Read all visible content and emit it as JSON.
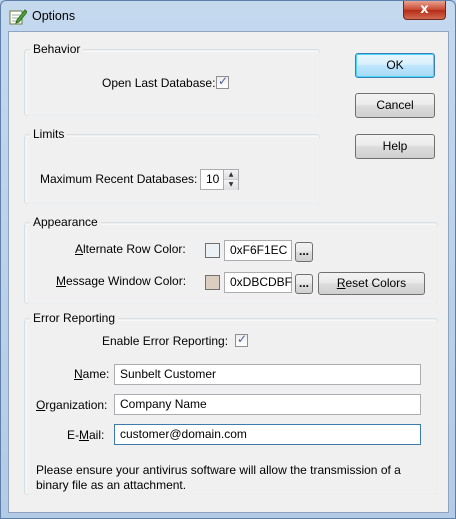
{
  "window": {
    "title": "Options",
    "close_glyph": "x",
    "icon": "notepad-pencil-icon"
  },
  "behavior": {
    "group_label": "Behavior",
    "open_last_db_label": "Open Last Database:",
    "open_last_db_checked": true
  },
  "limits": {
    "group_label": "Limits",
    "max_recent_label": "Maximum Recent Databases:",
    "max_recent_value": "10"
  },
  "appearance": {
    "group_label": "Appearance",
    "alt_row_label": "Alternate Row Color:",
    "alt_row_value": "0xF6F1EC",
    "alt_row_swatch": "#ECF1F6",
    "msg_window_label": "Message Window Color:",
    "msg_window_value": "0xDBCDBF",
    "msg_window_swatch": "#DBCDBF",
    "browse_label": "...",
    "reset_label": "Reset Colors"
  },
  "error_reporting": {
    "group_label": "Error Reporting",
    "enable_label": "Enable Error Reporting:",
    "enable_checked": true,
    "name_label": "Name:",
    "name_value": "Sunbelt Customer",
    "org_label": "Organization:",
    "org_value": "Company Name",
    "email_label": "E-Mail:",
    "email_value": "customer@domain.com",
    "note": "Please ensure your antivirus software will allow the transmission of a binary file as an attachment."
  },
  "buttons": {
    "ok": "OK",
    "cancel": "Cancel",
    "help": "Help"
  }
}
